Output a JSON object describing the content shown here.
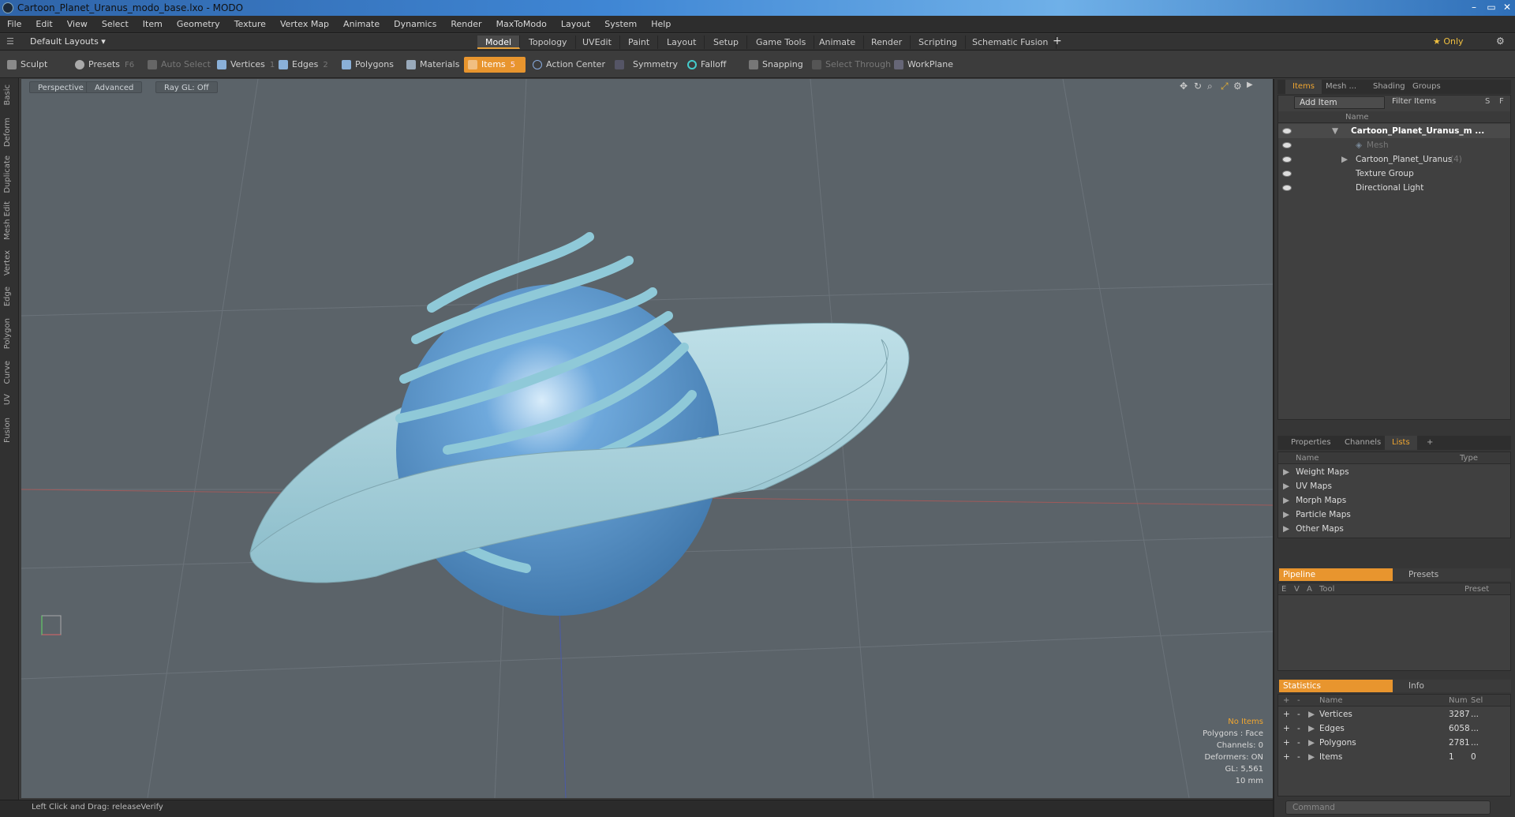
{
  "window": {
    "title": "Cartoon_Planet_Uranus_modo_base.lxo - MODO",
    "minimize": "–",
    "maximize": "▭",
    "close": "✕"
  },
  "menu": [
    "File",
    "Edit",
    "View",
    "Select",
    "Item",
    "Geometry",
    "Texture",
    "Vertex Map",
    "Animate",
    "Dynamics",
    "Render",
    "MaxToModo",
    "Layout",
    "System",
    "Help"
  ],
  "layoutbar": {
    "layout_label": "Default Layouts ▾",
    "tabs": [
      "Model",
      "Topology",
      "UVEdit",
      "Paint",
      "Layout",
      "Setup",
      "Game Tools",
      "Animate",
      "Render",
      "Scripting",
      "Schematic Fusion"
    ],
    "active_tab": "Model",
    "add": "+",
    "only_label": "★ Only",
    "gear": "⚙"
  },
  "toolbar": {
    "sculpt": "Sculpt",
    "presets": "Presets",
    "presets_key": "F6",
    "auto_select": "Auto Select",
    "vertices": "Vertices",
    "vertices_key": "1",
    "edges": "Edges",
    "edges_key": "2",
    "polygons": "Polygons",
    "materials": "Materials",
    "items": "Items",
    "items_key": "5",
    "action_center": "Action Center",
    "symmetry": "Symmetry",
    "falloff": "Falloff",
    "snapping": "Snapping",
    "select_through": "Select Through",
    "workplane": "WorkPlane"
  },
  "lefttabs": [
    "Basic",
    "Deform",
    "Duplicate",
    "Mesh Edit",
    "Vertex",
    "Edge",
    "Polygon",
    "Curve",
    "UV",
    "Fusion"
  ],
  "viewport": {
    "view": "Perspective",
    "shading": "Advanced",
    "raygl": "Ray GL: Off",
    "stats": [
      "No Items",
      "Polygons : Face",
      "Channels: 0",
      "Deformers: ON",
      "GL: 5,561",
      "10 mm"
    ]
  },
  "status": {
    "hint_label": "Left Click and Drag:",
    "hint_value": "releaseVerify"
  },
  "items_panel": {
    "tabs": [
      "Items",
      "Mesh ...",
      "Shading",
      "Groups"
    ],
    "add_item": "Add Item",
    "filter": "Filter Items",
    "btn_s": "S",
    "btn_f": "F",
    "col_name": "Name",
    "rows": [
      {
        "label": "Cartoon_Planet_Uranus_m ...",
        "bold": true
      },
      {
        "label": "Mesh"
      },
      {
        "label": "Cartoon_Planet_Uranus",
        "suffix": "(4)"
      },
      {
        "label": "Texture Group"
      },
      {
        "label": "Directional Light"
      }
    ]
  },
  "lists_panel": {
    "tabs": [
      "Properties",
      "Channels",
      "Lists"
    ],
    "add": "+",
    "col_name": "Name",
    "col_type": "Type",
    "rows": [
      "Weight Maps",
      "UV Maps",
      "Morph Maps",
      "Particle Maps",
      "Other Maps"
    ]
  },
  "pipeline_panel": {
    "tab_active": "Pipeline",
    "tab_other": "Presets",
    "cols": [
      "E",
      "V",
      "A",
      "Tool",
      "Preset"
    ]
  },
  "stats_panel": {
    "tab_active": "Statistics",
    "tab_other": "Info",
    "cols": [
      "+",
      "-",
      "Name",
      "Num",
      "Sel"
    ],
    "rows": [
      {
        "name": "Vertices",
        "num": "3287",
        "sel": "..."
      },
      {
        "name": "Edges",
        "num": "6058",
        "sel": "..."
      },
      {
        "name": "Polygons",
        "num": "2781",
        "sel": "..."
      },
      {
        "name": "Items",
        "num": "1",
        "sel": "0"
      }
    ]
  },
  "command": {
    "placeholder": "Command"
  },
  "colors": {
    "accent": "#e8952e",
    "viewport_bg": "#5b6369",
    "planet": "#4f8fc9",
    "ring": "#a8d3dd"
  }
}
